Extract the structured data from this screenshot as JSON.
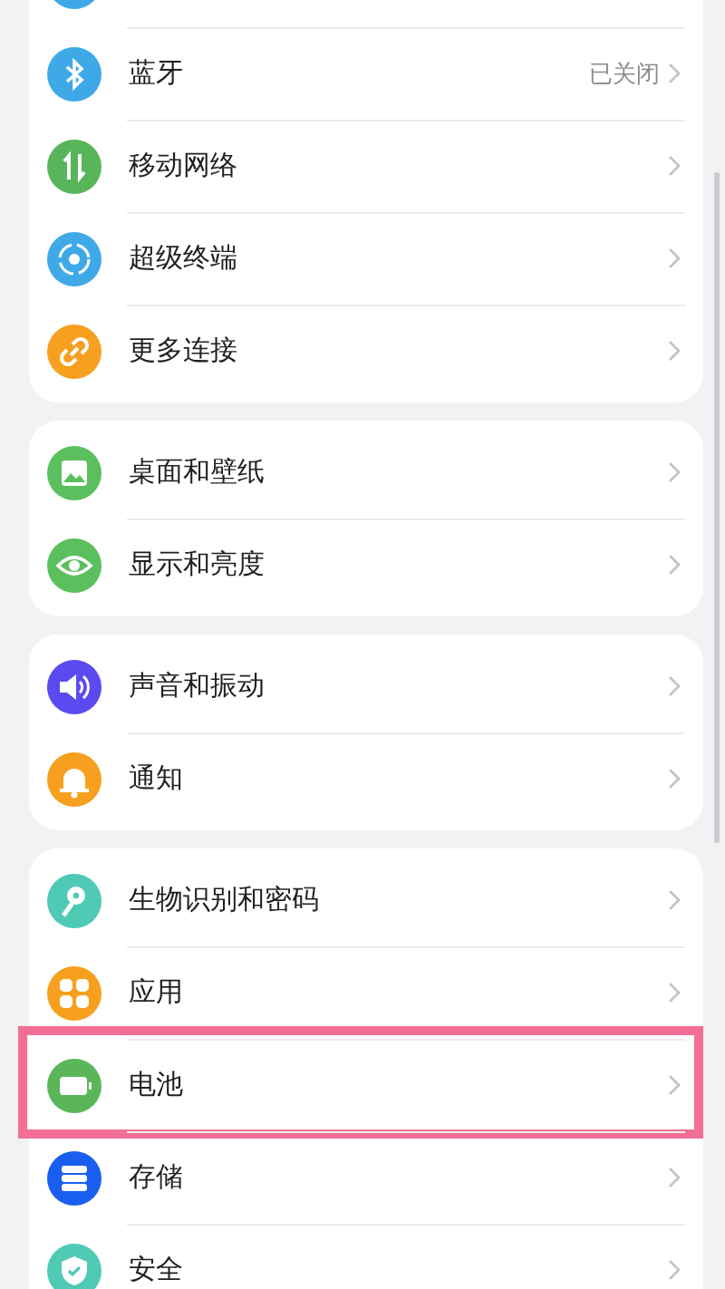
{
  "groups": [
    {
      "items": [
        {
          "color": "#3fa9e8"
        },
        {
          "label": "蓝牙",
          "value": "已关闭",
          "color": "#3fa9e8"
        },
        {
          "label": "移动网络",
          "color": "#58b55a"
        },
        {
          "label": "超级终端",
          "color": "#3fa9e8"
        },
        {
          "label": "更多连接",
          "color": "#f7a020"
        }
      ]
    },
    {
      "items": [
        {
          "label": "桌面和壁纸",
          "color": "#5bbf5e"
        },
        {
          "label": "显示和亮度",
          "color": "#5bbf5e"
        }
      ]
    },
    {
      "items": [
        {
          "label": "声音和振动",
          "color": "#5a4af0"
        },
        {
          "label": "通知",
          "color": "#f7a020"
        }
      ]
    },
    {
      "items": [
        {
          "label": "生物识别和密码",
          "color": "#4ecab5",
          "highlighted": false
        },
        {
          "label": "应用",
          "color": "#f7a020",
          "highlighted": false
        },
        {
          "label": "电池",
          "color": "#5bb65a",
          "highlighted": true
        },
        {
          "label": "存储",
          "color": "#1a5ef0",
          "highlighted": false
        },
        {
          "label": "安全",
          "color": "#4ecab5",
          "highlighted": false
        }
      ]
    }
  ]
}
